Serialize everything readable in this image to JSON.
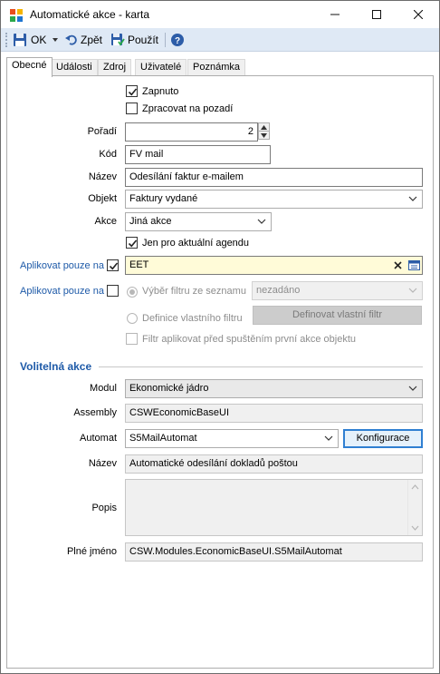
{
  "window": {
    "title": "Automatické akce - karta",
    "minimize_glyph": "─",
    "maximize_glyph": "☐",
    "close_glyph": "✕"
  },
  "toolbar": {
    "ok_label": "OK",
    "back_label": "Zpět",
    "apply_label": "Použít"
  },
  "tabs": [
    {
      "label": "Obecné",
      "active": true
    },
    {
      "label": "Události",
      "active": false
    },
    {
      "label": "Zdroj",
      "active": false
    },
    {
      "label": "Uživatelé",
      "active": false
    },
    {
      "label": "Poznámka",
      "active": false
    }
  ],
  "general": {
    "enabled_label": "Zapnuto",
    "enabled": true,
    "background_label": "Zpracovat na pozadí",
    "background": false,
    "order_label": "Pořadí",
    "order_value": "2",
    "code_label": "Kód",
    "code_value": "FV mail",
    "name_label": "Název",
    "name_value": "Odesílání faktur e-mailem",
    "object_label": "Objekt",
    "object_value": "Faktury vydané",
    "action_label": "Akce",
    "action_value": "Jiná akce",
    "agenda_label": "Jen pro aktuální agendu",
    "agenda_checked": true,
    "apply_only1_label": "Aplikovat pouze na",
    "apply_only1_checked": true,
    "apply_only1_value": "EET",
    "apply_only2_label": "Aplikovat pouze na",
    "apply_only2_checked": false,
    "filter_select_label": "Výběr filtru ze seznamu",
    "filter_select_value": "nezadáno",
    "custom_filter_label": "Definice vlastního filtru",
    "custom_filter_button": "Definovat vlastní filtr",
    "filter_before_label": "Filtr aplikovat před spuštěním první akce objektu"
  },
  "optional": {
    "section_title": "Volitelná akce",
    "module_label": "Modul",
    "module_value": "Ekonomické jádro",
    "assembly_label": "Assembly",
    "assembly_value": "CSWEconomicBaseUI",
    "automat_label": "Automat",
    "automat_value": "S5MailAutomat",
    "config_button": "Konfigurace",
    "name_label": "Název",
    "name_value": "Automatické odesílání dokladů poštou",
    "description_label": "Popis",
    "description_value": "",
    "fullname_label": "Plné jméno",
    "fullname_value": "CSW.Modules.EconomicBaseUI.S5MailAutomat"
  },
  "colors": {
    "toolbar_bg": "#dfe9f5",
    "link_blue": "#1e5aa8",
    "highlight_yellow": "#fffbd8",
    "focus_blue": "#2f7fd2"
  }
}
